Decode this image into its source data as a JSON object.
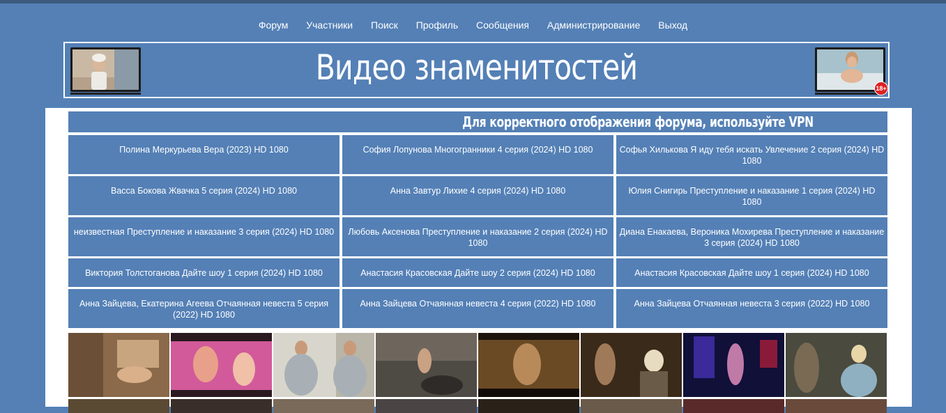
{
  "nav": {
    "items": [
      "Форум",
      "Участники",
      "Поиск",
      "Профиль",
      "Сообщения",
      "Администрирование",
      "Выход"
    ]
  },
  "banner": {
    "title": "Видео знаменитостей",
    "badge": "18+"
  },
  "notice": {
    "text": "Для корректного отображения форума, используйте VPN"
  },
  "topics": [
    "Полина Меркурьева Вера (2023) HD 1080",
    "София Лопунова Многогранники 4 серия (2024) HD 1080",
    "Софья Хилькова Я иду тебя искать Увлечение 2 серия (2024) HD 1080",
    "Васса Бокова Жвачка 5 серия (2024) HD 1080",
    "Анна Завтур Лихие 4 серия (2024) HD 1080",
    "Юлия Снигирь Преступление и наказание 1 серия (2024) HD 1080",
    "неизвестная Преступление и наказание 3 серия (2024) HD 1080",
    "Любовь Аксенова Преступление и наказание 2 серия (2024) HD 1080",
    "Диана Енакаева, Вероника Мохирева Преступление и наказание 3 серия (2024) HD 1080",
    "Виктория Толстоганова Дайте шоу 1 серия (2024) HD 1080",
    "Анастасия Красовская Дайте шоу 2 серия (2024) HD 1080",
    "Анастасия Красовская Дайте шоу 1 серия (2024) HD 1080",
    "Анна Зайцева, Екатерина Агеева Отчаянная невеста 5 серия (2022) HD 1080",
    "Анна Зайцева Отчаянная невеста 4 серия (2022) HD 1080",
    "Анна Зайцева Отчаянная невеста 3 серия (2022) HD 1080"
  ],
  "colors": {
    "background": "#5480b6",
    "content": "#ffffff",
    "text": "#ffffff"
  }
}
